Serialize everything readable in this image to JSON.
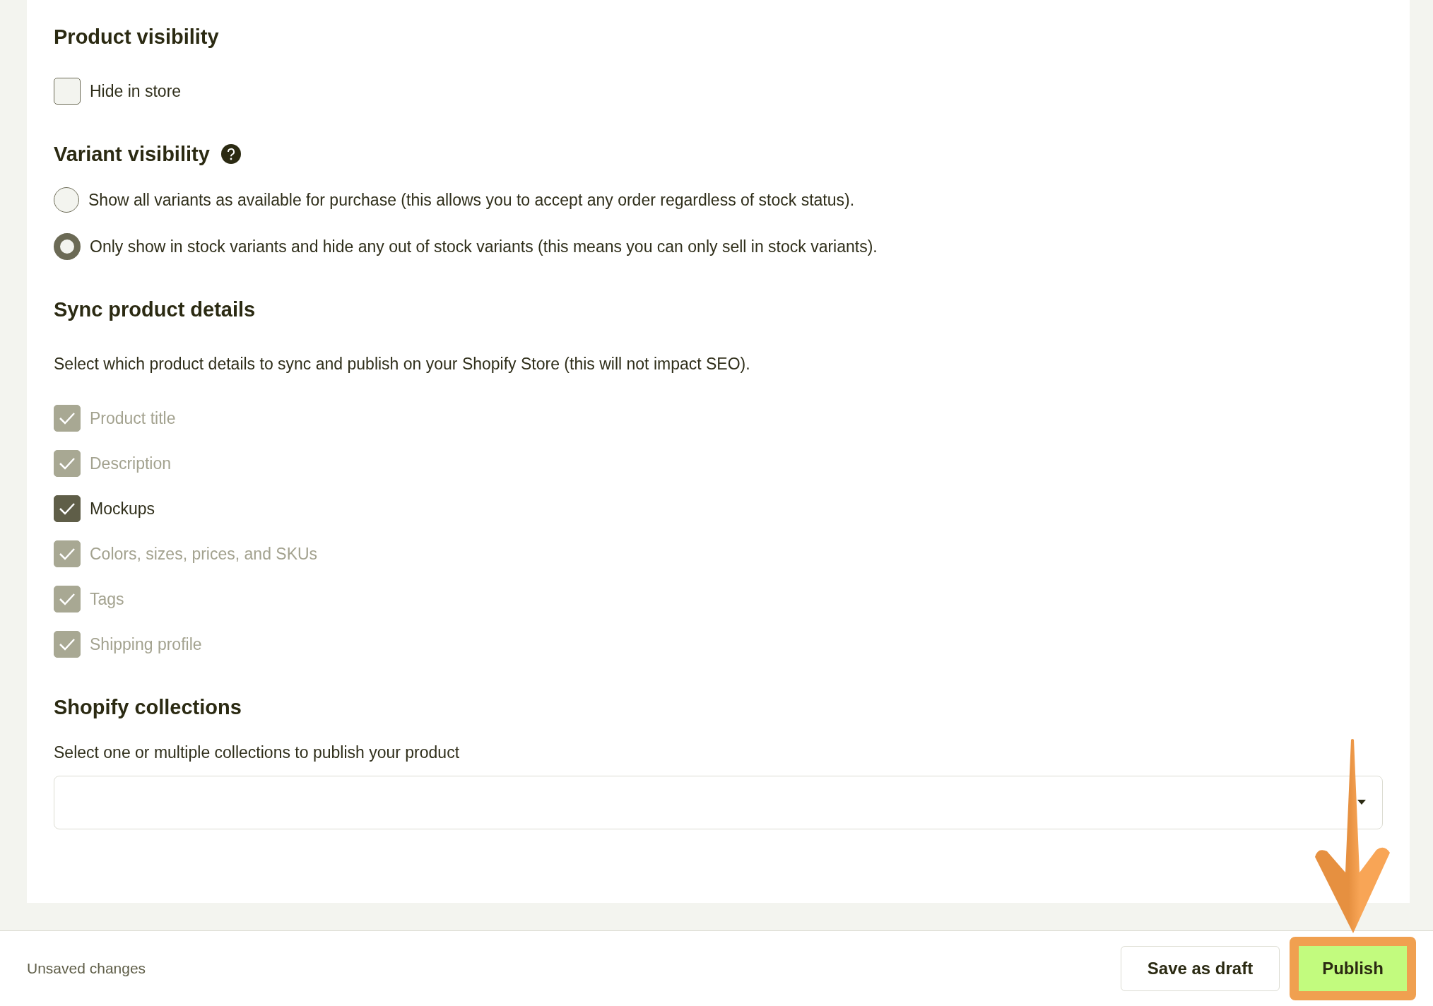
{
  "product_visibility": {
    "title": "Product visibility",
    "hide_in_store": {
      "label": "Hide in store",
      "checked": false
    }
  },
  "variant_visibility": {
    "title": "Variant visibility",
    "options": [
      {
        "label": "Show all variants as available for purchase (this allows you to accept any order regardless of stock status).",
        "selected": false
      },
      {
        "label": "Only show in stock variants and hide any out of stock variants (this means you can only sell in stock variants).",
        "selected": true
      }
    ]
  },
  "sync_product_details": {
    "title": "Sync product details",
    "description": "Select which product details to sync and publish on your Shopify Store (this will not impact SEO).",
    "items": [
      {
        "label": "Product title",
        "checked": true,
        "disabled": true
      },
      {
        "label": "Description",
        "checked": true,
        "disabled": true
      },
      {
        "label": "Mockups",
        "checked": true,
        "disabled": false
      },
      {
        "label": "Colors, sizes, prices, and SKUs",
        "checked": true,
        "disabled": true
      },
      {
        "label": "Tags",
        "checked": true,
        "disabled": true
      },
      {
        "label": "Shipping profile",
        "checked": true,
        "disabled": true
      }
    ]
  },
  "shopify_collections": {
    "title": "Shopify collections",
    "description": "Select one or multiple collections to publish your product"
  },
  "footer": {
    "status": "Unsaved changes",
    "buttons": [
      {
        "label": "Save as draft",
        "kind": "secondary"
      },
      {
        "label": "Publish",
        "kind": "primary",
        "highlighted": true
      }
    ]
  }
}
